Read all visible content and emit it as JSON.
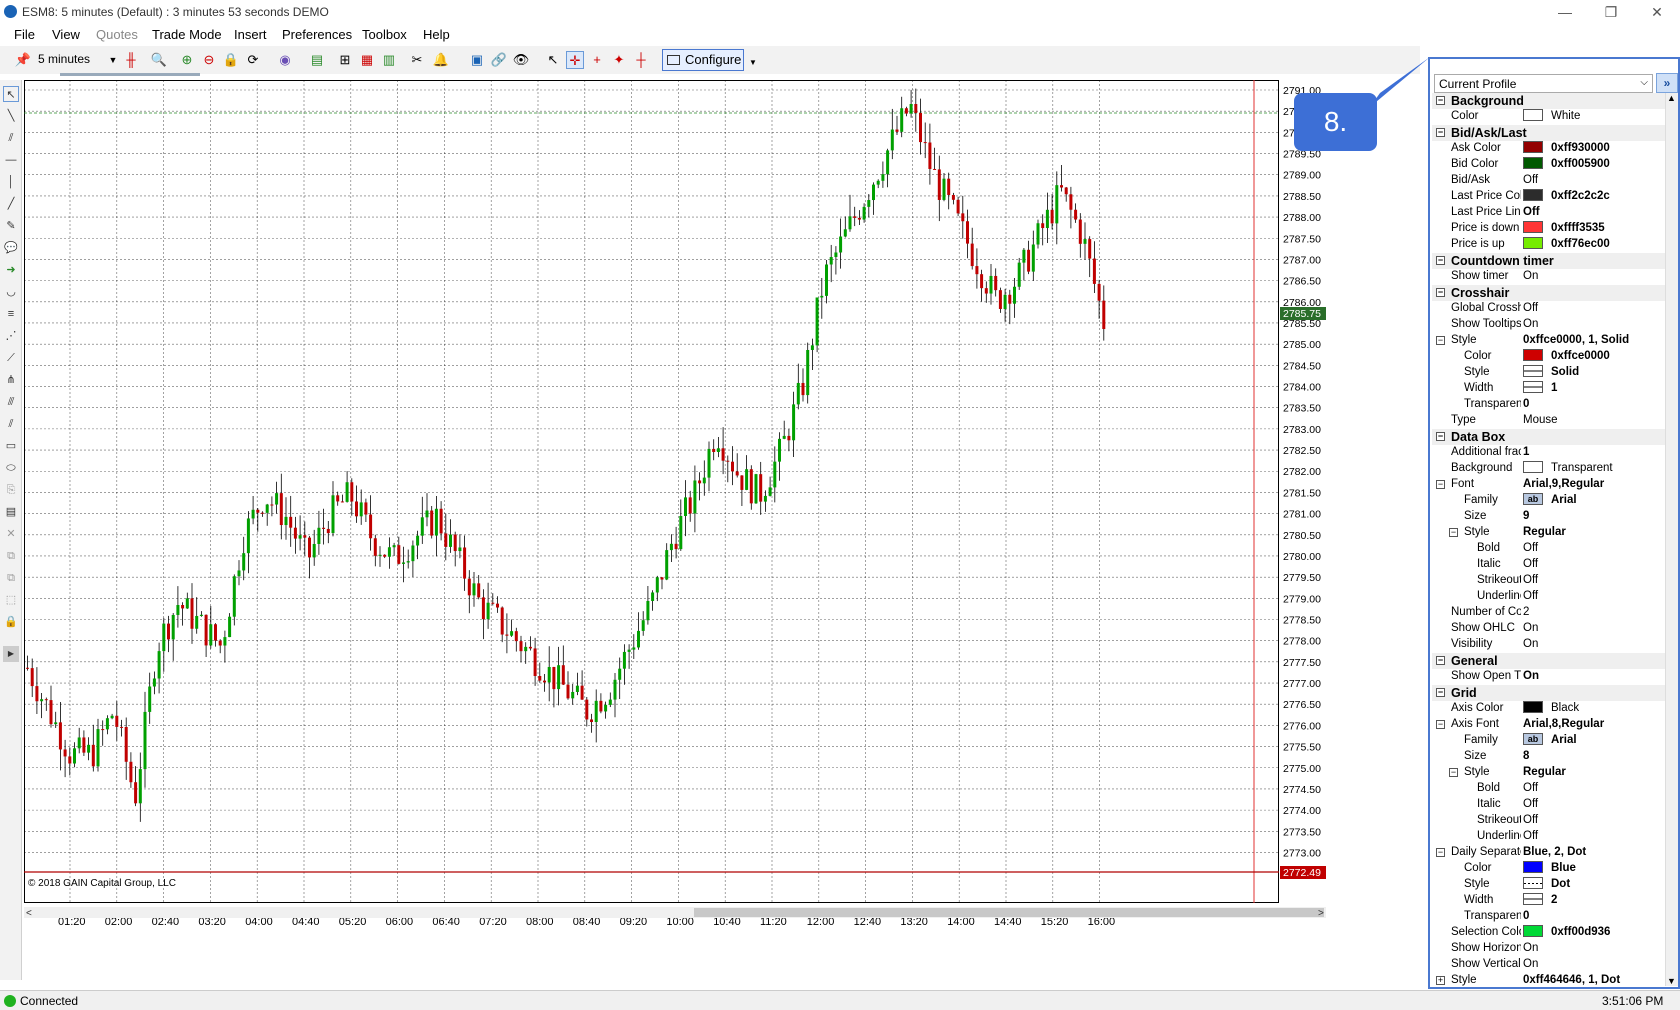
{
  "window": {
    "title": "ESM8: 5 minutes (Default) : 3 minutes 53 seconds DEMO"
  },
  "menu": [
    "File",
    "View",
    "Quotes",
    "Trade Mode",
    "Insert",
    "Preferences",
    "Toolbox",
    "Help"
  ],
  "toolbar": {
    "interval": "5 minutes",
    "configure": "Configure"
  },
  "callout": "8.",
  "chart": {
    "price_labels": [
      "2791.00",
      "2790.50",
      "2790.00",
      "2789.50",
      "2789.00",
      "2788.50",
      "2788.00",
      "2787.50",
      "2787.00",
      "2786.50",
      "2786.00",
      "2785.50",
      "2785.00",
      "2784.50",
      "2784.00",
      "2783.50",
      "2783.00",
      "2782.50",
      "2782.00",
      "2781.50",
      "2781.00",
      "2780.50",
      "2780.00",
      "2779.50",
      "2779.00",
      "2778.50",
      "2778.00",
      "2777.50",
      "2777.00",
      "2776.50",
      "2776.00",
      "2775.50",
      "2775.00",
      "2774.50",
      "2774.00",
      "2773.50",
      "2773.00"
    ],
    "time_labels": [
      "01:20",
      "02:00",
      "02:40",
      "03:20",
      "04:00",
      "04:40",
      "05:20",
      "06:00",
      "06:40",
      "07:20",
      "08:00",
      "08:40",
      "09:20",
      "10:00",
      "10:40",
      "11:20",
      "12:00",
      "12:40",
      "13:20",
      "14:00",
      "14:40",
      "15:20",
      "16:00"
    ],
    "last_price": "2785.75",
    "bottom_price": "2772.49",
    "copyright": "© 2018 GAIN Capital Group, LLC",
    "colors": {
      "up": "#00a000",
      "down": "#c00000",
      "grid": "#000000"
    }
  },
  "chart_data": {
    "type": "candlestick",
    "ylim": [
      2772.5,
      2791.0
    ],
    "closes_approx": [
      2777.5,
      2776.5,
      2775.5,
      2775.5,
      2776.5,
      2774.5,
      2778.0,
      2779.0,
      2778.5,
      2778.0,
      2780.5,
      2781.5,
      2781.0,
      2780.0,
      2781.0,
      2781.5,
      2780.5,
      2780.0,
      2780.5,
      2781.0,
      2780.0,
      2779.0,
      2778.5,
      2778.0,
      2777.5,
      2777.0,
      2776.5,
      2777.0,
      2778.0,
      2779.0,
      2780.5,
      2781.5,
      2783.0,
      2782.0,
      2781.5,
      2782.5,
      2784.0,
      2786.5,
      2787.5,
      2788.5,
      2789.5,
      2790.5,
      2789.0,
      2788.0,
      2787.0,
      2786.0,
      2786.5,
      2787.5,
      2788.5,
      2787.5,
      2785.5
    ]
  },
  "panel": {
    "header": "Current Profile",
    "rows": [
      {
        "t": "cat",
        "n": "Background",
        "tog": "-"
      },
      {
        "n": "Color",
        "v": "White",
        "sw": "#ffffff"
      },
      {
        "t": "cat",
        "n": "Bid/Ask/Last",
        "tog": "-"
      },
      {
        "n": "Ask Color",
        "v": "0xff930000",
        "sw": "#930000",
        "b": 1
      },
      {
        "n": "Bid Color",
        "v": "0xff005900",
        "sw": "#005900",
        "b": 1
      },
      {
        "n": "Bid/Ask",
        "v": "Off"
      },
      {
        "n": "Last Price Colo",
        "v": "0xff2c2c2c",
        "sw": "#2c2c2c",
        "b": 1
      },
      {
        "n": "Last Price Line",
        "v": "Off",
        "b": 1
      },
      {
        "n": "Price is down",
        "v": "0xffff3535",
        "sw": "#ff3535",
        "b": 1
      },
      {
        "n": "Price is up",
        "v": "0xff76ec00",
        "sw": "#76ec00",
        "b": 1
      },
      {
        "t": "cat",
        "n": "Countdown timer",
        "tog": "-"
      },
      {
        "n": "Show timer",
        "v": "On"
      },
      {
        "t": "cat",
        "n": "Crosshair",
        "tog": "-"
      },
      {
        "n": "Global Crossha",
        "v": "Off"
      },
      {
        "n": "Show Tooltips",
        "v": "On"
      },
      {
        "n": "Style",
        "v": "0xffce0000, 1, Solid",
        "b": 1,
        "tog": "-"
      },
      {
        "n": "Color",
        "v": "0xffce0000",
        "sw": "#ce0000",
        "b": 1,
        "i": 1
      },
      {
        "n": "Style",
        "v": "Solid",
        "sw": "line",
        "b": 1,
        "i": 1
      },
      {
        "n": "Width",
        "v": "1",
        "sw": "line",
        "b": 1,
        "i": 1
      },
      {
        "n": "Transparenc",
        "v": "0",
        "b": 1,
        "i": 1
      },
      {
        "n": "Type",
        "v": "Mouse"
      },
      {
        "t": "cat",
        "n": "Data Box",
        "tog": "-"
      },
      {
        "n": "Additional fract",
        "v": "1",
        "b": 1
      },
      {
        "n": "Background",
        "v": "Transparent",
        "sw": "#ffffff"
      },
      {
        "n": "Font",
        "v": "Arial,9,Regular",
        "b": 1,
        "tog": "-"
      },
      {
        "n": "Family",
        "v": "Arial",
        "sw": "ab",
        "b": 1,
        "i": 1
      },
      {
        "n": "Size",
        "v": "9",
        "b": 1,
        "i": 1
      },
      {
        "n": "Style",
        "v": "Regular",
        "b": 1,
        "i": 1,
        "tog": "-"
      },
      {
        "n": "Bold",
        "v": "Off",
        "i": 2
      },
      {
        "n": "Italic",
        "v": "Off",
        "i": 2
      },
      {
        "n": "Strikeout",
        "v": "Off",
        "i": 2
      },
      {
        "n": "Underline",
        "v": "Off",
        "i": 2
      },
      {
        "n": "Number of Colu",
        "v": "2"
      },
      {
        "n": "Show OHLC",
        "v": "On"
      },
      {
        "n": "Visibility",
        "v": "On"
      },
      {
        "t": "cat",
        "n": "General",
        "tog": "-"
      },
      {
        "n": "Show Open Tir",
        "v": "On",
        "b": 1
      },
      {
        "t": "cat",
        "n": "Grid",
        "tog": "-"
      },
      {
        "n": "Axis Color",
        "v": "Black",
        "sw": "#000000"
      },
      {
        "n": "Axis Font",
        "v": "Arial,8,Regular",
        "b": 1,
        "tog": "-"
      },
      {
        "n": "Family",
        "v": "Arial",
        "sw": "ab",
        "b": 1,
        "i": 1
      },
      {
        "n": "Size",
        "v": "8",
        "b": 1,
        "i": 1
      },
      {
        "n": "Style",
        "v": "Regular",
        "b": 1,
        "i": 1,
        "tog": "-"
      },
      {
        "n": "Bold",
        "v": "Off",
        "i": 2
      },
      {
        "n": "Italic",
        "v": "Off",
        "i": 2
      },
      {
        "n": "Strikeout",
        "v": "Off",
        "i": 2
      },
      {
        "n": "Underline",
        "v": "Off",
        "i": 2
      },
      {
        "n": "Daily Separator",
        "v": "Blue, 2, Dot",
        "b": 1,
        "tog": "-"
      },
      {
        "n": "Color",
        "v": "Blue",
        "sw": "#0000ff",
        "b": 1,
        "i": 1
      },
      {
        "n": "Style",
        "v": "Dot",
        "sw": "dot",
        "b": 1,
        "i": 1
      },
      {
        "n": "Width",
        "v": "2",
        "sw": "line",
        "b": 1,
        "i": 1
      },
      {
        "n": "Transparenc",
        "v": "0",
        "b": 1,
        "i": 1
      },
      {
        "n": "Selection Color",
        "v": "0xff00d936",
        "sw": "#00d936",
        "b": 1
      },
      {
        "n": "Show Horizont",
        "v": "On"
      },
      {
        "n": "Show Vertical",
        "v": "On"
      },
      {
        "n": "Style",
        "v": "0xff464646, 1, Dot",
        "b": 1,
        "tog": "+"
      }
    ]
  },
  "status": {
    "left": "Connected",
    "right": "3:51:06 PM"
  }
}
